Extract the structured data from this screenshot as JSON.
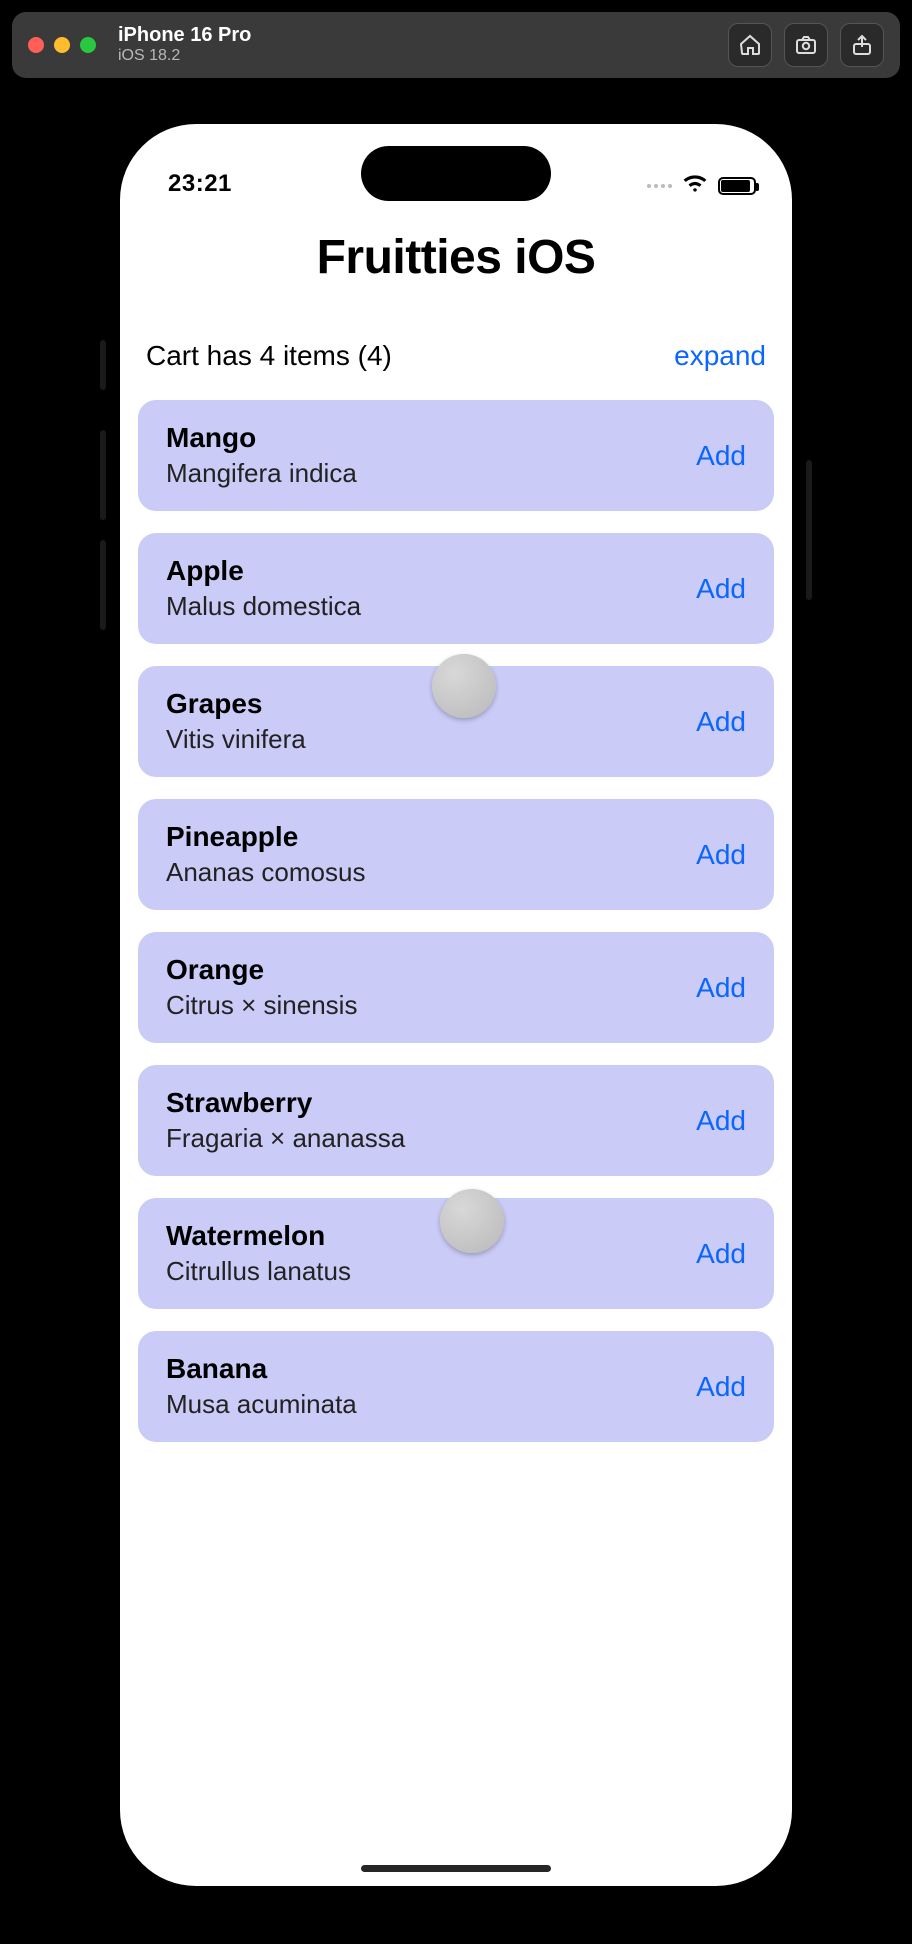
{
  "simulator": {
    "device": "iPhone 16 Pro",
    "os": "iOS 18.2"
  },
  "status": {
    "time": "23:21"
  },
  "app": {
    "title": "Fruitties iOS",
    "cart_text": "Cart has 4 items (4)",
    "expand_label": "expand",
    "add_label": "Add",
    "fruits": [
      {
        "name": "Mango",
        "sci": "Mangifera indica"
      },
      {
        "name": "Apple",
        "sci": "Malus domestica"
      },
      {
        "name": "Grapes",
        "sci": "Vitis vinifera"
      },
      {
        "name": "Pineapple",
        "sci": "Ananas comosus"
      },
      {
        "name": "Orange",
        "sci": "Citrus × sinensis"
      },
      {
        "name": "Strawberry",
        "sci": "Fragaria × ananassa"
      },
      {
        "name": "Watermelon",
        "sci": "Citrullus lanatus"
      },
      {
        "name": "Banana",
        "sci": "Musa acuminata"
      }
    ]
  }
}
